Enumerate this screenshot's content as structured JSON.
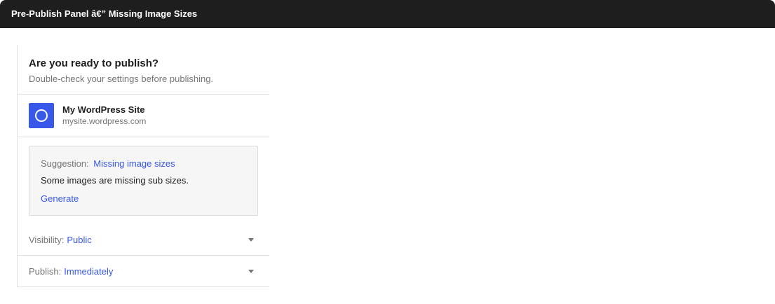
{
  "window": {
    "title": "Pre-Publish Panel â€” Missing Image Sizes"
  },
  "header": {
    "title": "Are you ready to publish?",
    "subtitle": "Double-check your settings before publishing."
  },
  "site": {
    "name": "My WordPress Site",
    "url": "mysite.wordpress.com",
    "icon": "site-circle-icon",
    "icon_color": "#3858e9"
  },
  "suggestion": {
    "label": "Suggestion:",
    "title": "Missing image sizes",
    "message": "Some images are missing sub sizes.",
    "action": "Generate"
  },
  "settings": {
    "visibility": {
      "label": "Visibility:",
      "value": "Public"
    },
    "publish": {
      "label": "Publish:",
      "value": "Immediately"
    }
  },
  "colors": {
    "accent": "#3858e9",
    "titlebar": "#1e1e1e"
  }
}
